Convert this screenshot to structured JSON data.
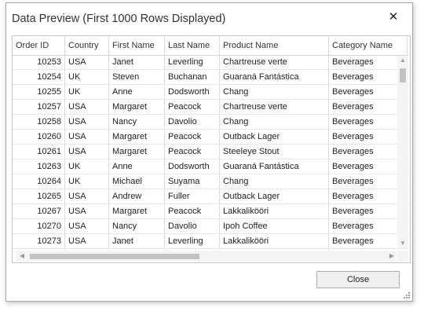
{
  "dialog": {
    "title": "Data Preview (First 1000 Rows Displayed)",
    "close_glyph": "✕",
    "close_button_label": "Close"
  },
  "grid": {
    "columns": [
      "Order ID",
      "Country",
      "First Name",
      "Last Name",
      "Product Name",
      "Category Name"
    ],
    "rows": [
      [
        "10253",
        "USA",
        "Janet",
        "Leverling",
        "Chartreuse verte",
        "Beverages"
      ],
      [
        "10254",
        "UK",
        "Steven",
        "Buchanan",
        "Guaraná Fantástica",
        "Beverages"
      ],
      [
        "10255",
        "UK",
        "Anne",
        "Dodsworth",
        "Chang",
        "Beverages"
      ],
      [
        "10257",
        "USA",
        "Margaret",
        "Peacock",
        "Chartreuse verte",
        "Beverages"
      ],
      [
        "10258",
        "USA",
        "Nancy",
        "Davolio",
        "Chang",
        "Beverages"
      ],
      [
        "10260",
        "USA",
        "Margaret",
        "Peacock",
        "Outback Lager",
        "Beverages"
      ],
      [
        "10261",
        "USA",
        "Margaret",
        "Peacock",
        "Steeleye Stout",
        "Beverages"
      ],
      [
        "10263",
        "UK",
        "Anne",
        "Dodsworth",
        "Guaraná Fantástica",
        "Beverages"
      ],
      [
        "10264",
        "UK",
        "Michael",
        "Suyama",
        "Chang",
        "Beverages"
      ],
      [
        "10265",
        "USA",
        "Andrew",
        "Fuller",
        "Outback Lager",
        "Beverages"
      ],
      [
        "10267",
        "USA",
        "Margaret",
        "Peacock",
        "Lakkalikööri",
        "Beverages"
      ],
      [
        "10270",
        "USA",
        "Nancy",
        "Davolio",
        "Ipoh Coffee",
        "Beverages"
      ],
      [
        "10273",
        "USA",
        "Janet",
        "Leverling",
        "Lakkalikööri",
        "Beverages"
      ]
    ]
  },
  "scrollbars": {
    "up_glyph": "▲",
    "down_glyph": "▼",
    "left_glyph": "◀",
    "right_glyph": "▶"
  }
}
